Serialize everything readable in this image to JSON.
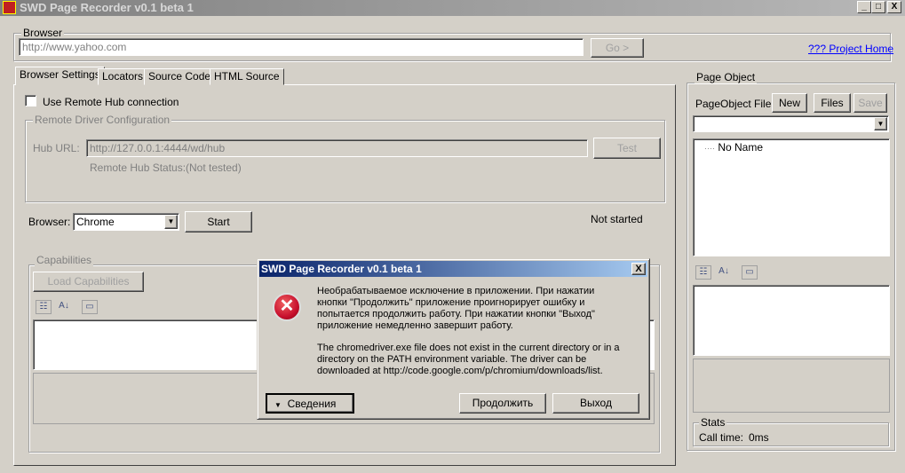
{
  "window": {
    "title": "SWD Page Recorder v0.1 beta 1",
    "controls": [
      "_",
      "□",
      "X"
    ]
  },
  "browser_group": {
    "label": "Browser",
    "url": "http://www.yahoo.com",
    "go": "Go >",
    "project_home": "??? Project Home"
  },
  "tabs": [
    "Browser Settings",
    "Locators",
    "Source Code",
    "HTML Source"
  ],
  "settings": {
    "use_remote": "Use Remote Hub connection",
    "remote_group": "Remote Driver Configuration",
    "hub_url_label": "Hub URL:",
    "hub_url": "http://127.0.0.1:4444/wd/hub",
    "test": "Test",
    "hub_status_label": "Remote Hub Status:",
    "hub_status": "(Not tested)",
    "browser_label": "Browser:",
    "browser_value": "Chrome",
    "start": "Start",
    "status": "Not started",
    "capabilities": "Capabilities",
    "load_capabilities": "Load Capabilities"
  },
  "page_object": {
    "label": "Page Object",
    "file_label": "PageObject File:",
    "new": "New",
    "files": "Files",
    "save": "Save",
    "tree_item": "No Name",
    "stats_label": "Stats",
    "call_time_label": "Call time:",
    "call_time": "0ms"
  },
  "dialog": {
    "title": "SWD Page Recorder v0.1 beta 1",
    "message_ru": "Необрабатываемое исключение в приложении. При нажатии кнопки \"Продолжить\" приложение проигнорирует ошибку и попытается продолжить работу. При нажатии кнопки \"Выход\" приложение немедленно завершит работу.",
    "message_en": "The chromedriver.exe file does not exist in the current directory or in a directory on the PATH environment variable. The driver can be downloaded at http://code.google.com/p/chromium/downloads/list.",
    "details": "Сведения",
    "continue": "Продолжить",
    "exit": "Выход",
    "close": "X"
  },
  "colors": {
    "dialog_title_start": "#0a246a",
    "dialog_title_end": "#a6caf0",
    "error_icon": "#c8102e"
  }
}
